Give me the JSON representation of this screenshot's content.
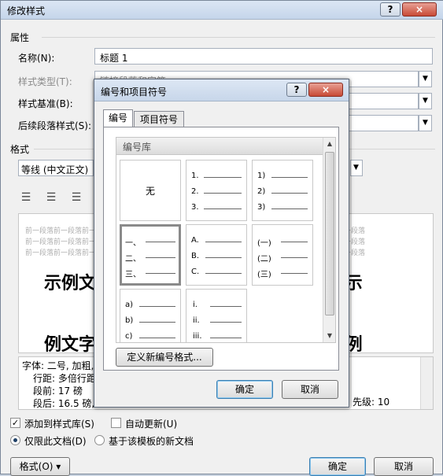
{
  "outer": {
    "title": "修改样式",
    "help": "?",
    "close": "×",
    "section_properties": "属性",
    "name_label": "名称(N):",
    "name_value": "标题 1",
    "style_type_label": "样式类型(T):",
    "style_type_value": "链接段落和字符",
    "style_based_label": "样式基准(B):",
    "next_para_label": "后续段落样式(S):",
    "section_format": "格式",
    "font_value": "等线 (中文正文)",
    "preview_faint": "前一段落前一段落前一段落前一段落前一段落前一段落前一段落前一段落前一段落前一段落前一段落前一段落",
    "preview_big_1": "示例文字 示例文字 示例文字 示例文字 示",
    "preview_big_2": "例文字 示例文字 示例文字 示例文字 示例",
    "desc_lines": [
      "字体: 二号, 加粗,",
      "行距: 多倍行距",
      "段前: 17 磅",
      "段后: 16.5 磅,"
    ],
    "desc_right": "先级: 10",
    "add_to_gallery": "添加到样式库(S)",
    "auto_update": "自动更新(U)",
    "only_this_doc": "仅限此文档(D)",
    "new_docs_template": "基于该模板的新文档",
    "format_button": "格式(O) ▾",
    "ok": "确定",
    "cancel": "取消"
  },
  "inner": {
    "title": "编号和项目符号",
    "help": "?",
    "close": "×",
    "tab_numbering": "编号",
    "tab_bullets": "项目符号",
    "library_header": "编号库",
    "none_label": "无",
    "formats": [
      [
        "1.",
        "2.",
        "3."
      ],
      [
        "1)",
        "2)",
        "3)"
      ],
      [
        "一、",
        "二、",
        "三、"
      ],
      [
        "A.",
        "B.",
        "C."
      ],
      [
        "(一)",
        "(二)",
        "(三)"
      ],
      [
        "a)",
        "b)",
        "c)"
      ],
      [
        "i.",
        "ii.",
        "iii."
      ]
    ],
    "define_new": "定义新编号格式...",
    "ok": "确定",
    "cancel": "取消"
  }
}
